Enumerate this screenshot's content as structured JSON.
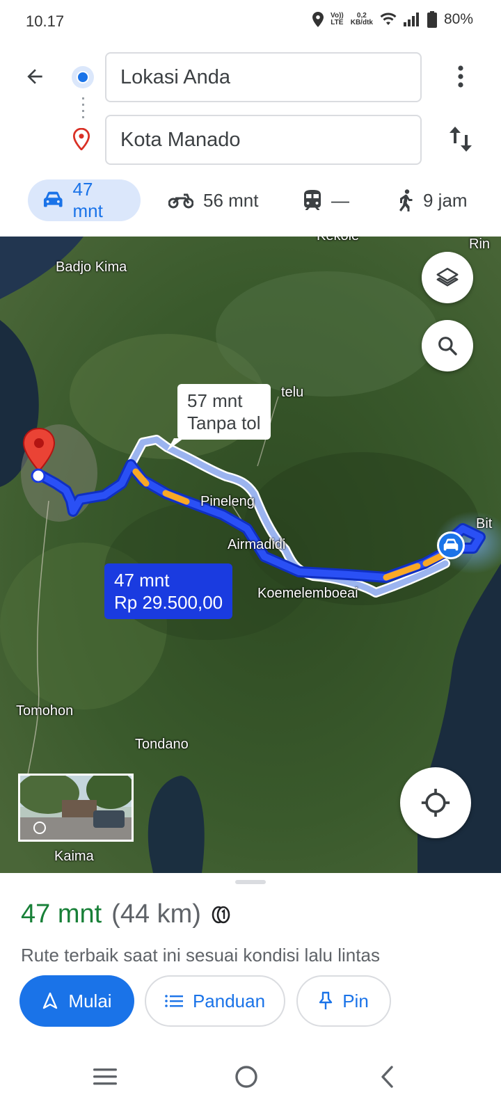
{
  "status_bar": {
    "time": "10.17",
    "volte_top": "Vo))",
    "volte_bottom": "LTE",
    "speed_value": "0,2",
    "speed_unit": "KB/dtk",
    "battery": "80%"
  },
  "directions": {
    "origin": "Lokasi Anda",
    "destination": "Kota Manado"
  },
  "travel_modes": [
    {
      "mode": "drive",
      "label": "47 mnt",
      "active": true
    },
    {
      "mode": "motorcycle",
      "label": "56 mnt",
      "active": false
    },
    {
      "mode": "transit",
      "label": "—",
      "active": false
    },
    {
      "mode": "walk",
      "label": "9 jam",
      "active": false
    }
  ],
  "map": {
    "places": [
      "Badjo Kima",
      "Pineleng",
      "Airmadidi",
      "Koemelemboeai",
      "Tomohon",
      "Tondano",
      "Kekole",
      "Rin",
      "telu",
      "Bit",
      "Kaima"
    ],
    "alt_route_callout": {
      "line1": "57 mnt",
      "line2": "Tanpa tol"
    },
    "main_route_callout": {
      "line1": "47 mnt",
      "line2": "Rp 29.500,00"
    }
  },
  "sheet": {
    "duration": "47 mnt",
    "distance": "(44 km)",
    "description": "Rute terbaik saat ini sesuai kondisi lalu lintas",
    "buttons": {
      "start": "Mulai",
      "steps": "Panduan",
      "pin": "Pin"
    }
  },
  "colors": {
    "accent": "#1a73e8",
    "route": "#1a3be0",
    "route_toll": "#f9a825",
    "duration_green": "#188038"
  }
}
